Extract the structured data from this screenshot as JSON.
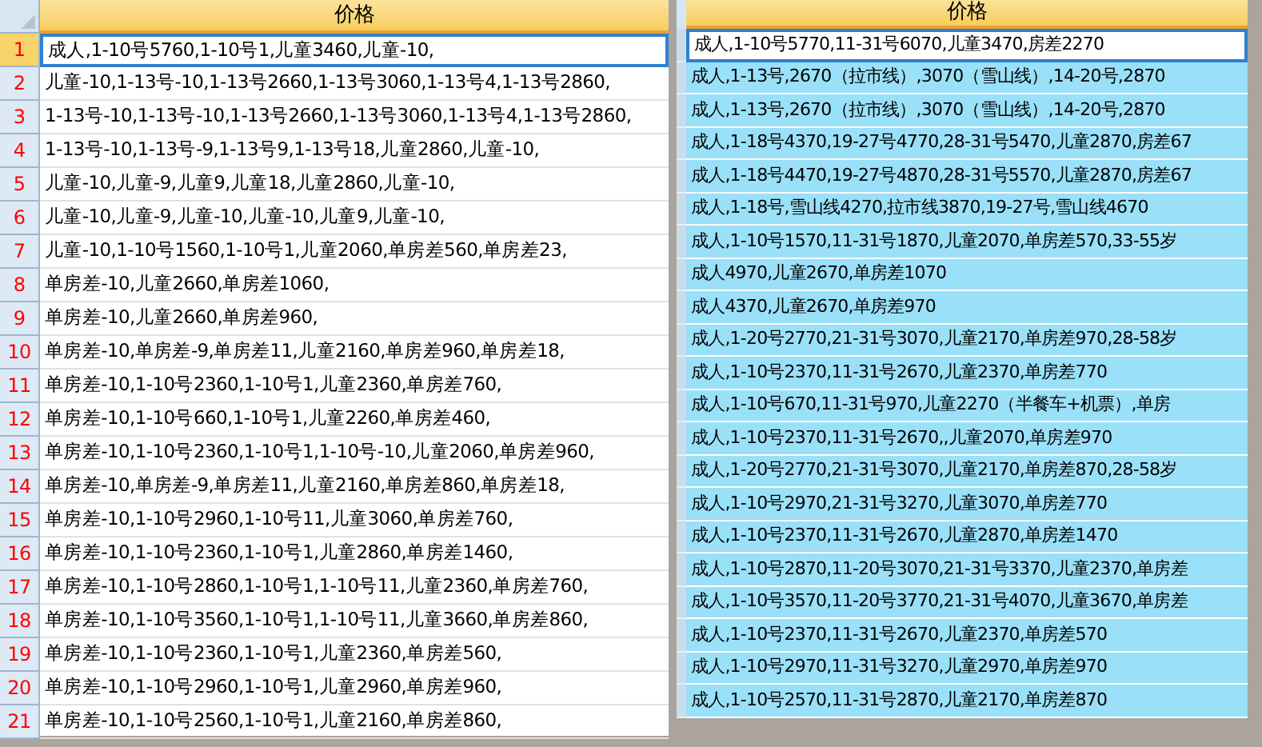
{
  "left_sheet": {
    "header": "价格",
    "rows": [
      {
        "number": "1",
        "text": "成人,1-10号5760,1-10号1,儿童3460,儿童-10,",
        "active": true
      },
      {
        "number": "2",
        "text": "儿童-10,1-13号-10,1-13号2660,1-13号3060,1-13号4,1-13号2860,",
        "active": false
      },
      {
        "number": "3",
        "text": "1-13号-10,1-13号-10,1-13号2660,1-13号3060,1-13号4,1-13号2860,",
        "active": false
      },
      {
        "number": "4",
        "text": "1-13号-10,1-13号-9,1-13号9,1-13号18,儿童2860,儿童-10,",
        "active": false
      },
      {
        "number": "5",
        "text": "儿童-10,儿童-9,儿童9,儿童18,儿童2860,儿童-10,",
        "active": false
      },
      {
        "number": "6",
        "text": "儿童-10,儿童-9,儿童-10,儿童-10,儿童9,儿童-10,",
        "active": false
      },
      {
        "number": "7",
        "text": "儿童-10,1-10号1560,1-10号1,儿童2060,单房差560,单房差23,",
        "active": false
      },
      {
        "number": "8",
        "text": "单房差-10,儿童2660,单房差1060,",
        "active": false
      },
      {
        "number": "9",
        "text": "单房差-10,儿童2660,单房差960,",
        "active": false
      },
      {
        "number": "10",
        "text": "单房差-10,单房差-9,单房差11,儿童2160,单房差960,单房差18,",
        "active": false
      },
      {
        "number": "11",
        "text": "单房差-10,1-10号2360,1-10号1,儿童2360,单房差760,",
        "active": false
      },
      {
        "number": "12",
        "text": "单房差-10,1-10号660,1-10号1,儿童2260,单房差460,",
        "active": false
      },
      {
        "number": "13",
        "text": "单房差-10,1-10号2360,1-10号1,1-10号-10,儿童2060,单房差960,",
        "active": false
      },
      {
        "number": "14",
        "text": "单房差-10,单房差-9,单房差11,儿童2160,单房差860,单房差18,",
        "active": false
      },
      {
        "number": "15",
        "text": "单房差-10,1-10号2960,1-10号11,儿童3060,单房差760,",
        "active": false
      },
      {
        "number": "16",
        "text": "单房差-10,1-10号2360,1-10号1,儿童2860,单房差1460,",
        "active": false
      },
      {
        "number": "17",
        "text": "单房差-10,1-10号2860,1-10号1,1-10号11,儿童2360,单房差760,",
        "active": false
      },
      {
        "number": "18",
        "text": "单房差-10,1-10号3560,1-10号1,1-10号11,儿童3660,单房差860,",
        "active": false
      },
      {
        "number": "19",
        "text": "单房差-10,1-10号2360,1-10号1,儿童2360,单房差560,",
        "active": false
      },
      {
        "number": "20",
        "text": "单房差-10,1-10号2960,1-10号1,儿童2960,单房差960,",
        "active": false
      },
      {
        "number": "21",
        "text": "单房差-10,1-10号2560,1-10号1,儿童2160,单房差860,",
        "active": false
      }
    ]
  },
  "right_sheet": {
    "header": "价格",
    "rows": [
      {
        "text": "成人,1-10号5770,11-31号6070,儿童3470,房差2270",
        "selected": true,
        "active": true
      },
      {
        "text": "成人,1-13号,2670（拉市线）,3070（雪山线）,14-20号,2870",
        "selected": true,
        "active": false
      },
      {
        "text": "成人,1-13号,2670（拉市线）,3070（雪山线）,14-20号,2870",
        "selected": true,
        "active": false
      },
      {
        "text": "成人,1-18号4370,19-27号4770,28-31号5470,儿童2870,房差67",
        "selected": true,
        "active": false
      },
      {
        "text": "成人,1-18号4470,19-27号4870,28-31号5570,儿童2870,房差67",
        "selected": true,
        "active": false
      },
      {
        "text": "成人,1-18号,雪山线4270,拉市线3870,19-27号,雪山线4670",
        "selected": true,
        "active": false
      },
      {
        "text": "成人,1-10号1570,11-31号1870,儿童2070,单房差570,33-55岁",
        "selected": true,
        "active": false
      },
      {
        "text": "成人4970,儿童2670,单房差1070",
        "selected": true,
        "active": false
      },
      {
        "text": "成人4370,儿童2670,单房差970",
        "selected": true,
        "active": false
      },
      {
        "text": "成人,1-20号2770,21-31号3070,儿童2170,单房差970,28-58岁",
        "selected": true,
        "active": false
      },
      {
        "text": "成人,1-10号2370,11-31号2670,儿童2370,单房差770",
        "selected": true,
        "active": false
      },
      {
        "text": "成人,1-10号670,11-31号970,儿童2270（半餐车+机票）,单房",
        "selected": true,
        "active": false
      },
      {
        "text": "成人,1-10号2370,11-31号2670,,儿童2070,单房差970",
        "selected": true,
        "active": false
      },
      {
        "text": "成人,1-20号2770,21-31号3070,儿童2170,单房差870,28-58岁",
        "selected": true,
        "active": false
      },
      {
        "text": "成人,1-10号2970,21-31号3270,儿童3070,单房差770",
        "selected": true,
        "active": false
      },
      {
        "text": "成人,1-10号2370,11-31号2670,儿童2870,单房差1470",
        "selected": true,
        "active": false
      },
      {
        "text": "成人,1-10号2870,11-20号3070,21-31号3370,儿童2370,单房差",
        "selected": true,
        "active": false
      },
      {
        "text": "成人,1-10号3570,11-20号3770,21-31号4070,儿童3670,单房差",
        "selected": true,
        "active": false
      },
      {
        "text": "成人,1-10号2370,11-31号2670,儿童2370,单房差570",
        "selected": true,
        "active": false
      },
      {
        "text": "成人,1-10号2970,11-31号3270,儿童2970,单房差970",
        "selected": true,
        "active": false
      },
      {
        "text": "成人,1-10号2570,11-31号2870,儿童2170,单房差870",
        "selected": true,
        "active": false
      }
    ]
  }
}
